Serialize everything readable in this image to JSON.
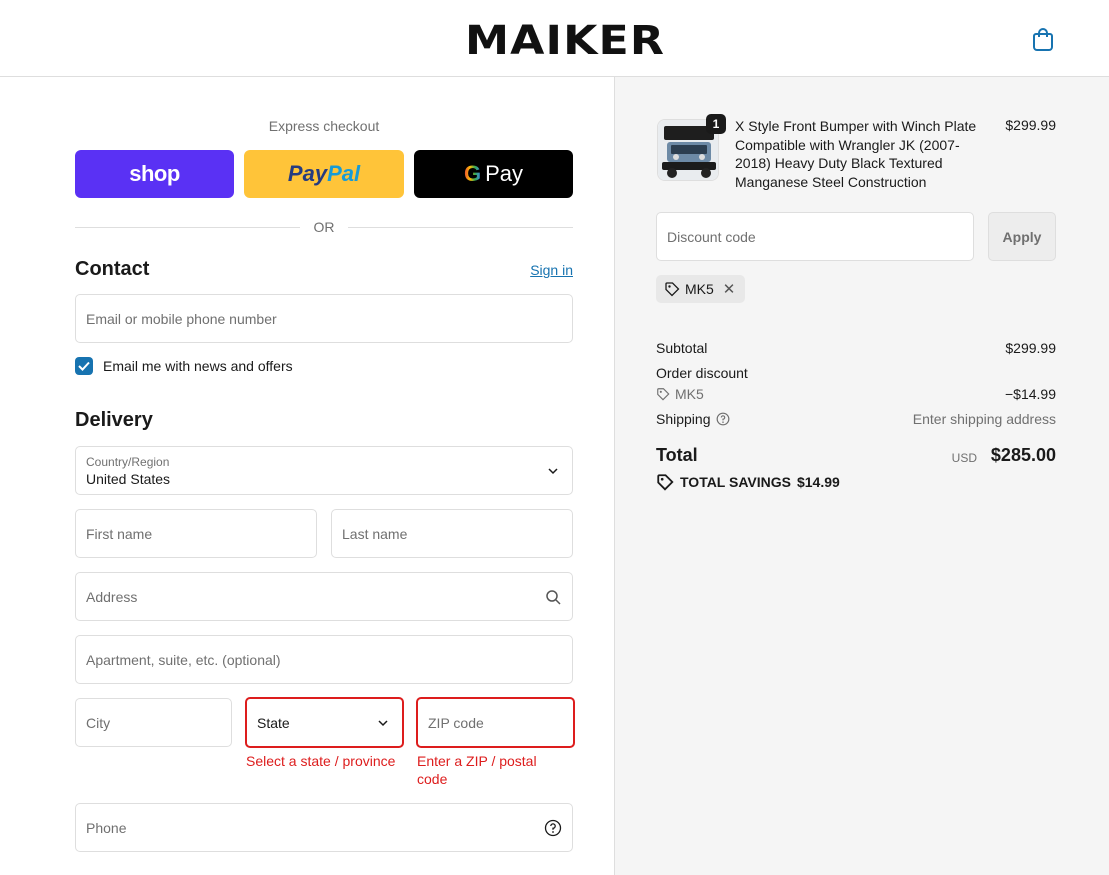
{
  "brand": {
    "logo_text": "MAIKER"
  },
  "express": {
    "title": "Express checkout",
    "shop_label": "shop",
    "paypal_label_1": "Pay",
    "paypal_label_2": "Pal",
    "gpay_g": "G",
    "gpay_label": "Pay",
    "or_text": "OR"
  },
  "contact": {
    "title": "Contact",
    "signin_label": "Sign in",
    "email_placeholder": "Email or mobile phone number",
    "newsletter_label": "Email me with news and offers",
    "newsletter_checked": true
  },
  "delivery": {
    "title": "Delivery",
    "country_label": "Country/Region",
    "country_value": "United States",
    "first_name_placeholder": "First name",
    "last_name_placeholder": "Last name",
    "address_placeholder": "Address",
    "apartment_placeholder": "Apartment, suite, etc. (optional)",
    "city_placeholder": "City",
    "state_placeholder": "State",
    "state_error": "Select a state / province",
    "zip_placeholder": "ZIP code",
    "zip_error": "Enter a ZIP / postal code",
    "phone_placeholder": "Phone"
  },
  "order": {
    "item": {
      "quantity": "1",
      "name": "X Style Front Bumper with Winch Plate Compatible with Wrangler JK (2007-2018) Heavy Duty Black Textured Manganese Steel Construction",
      "price": "$299.99"
    },
    "discount_placeholder": "Discount code",
    "apply_label": "Apply",
    "applied_code": "MK5",
    "subtotal_label": "Subtotal",
    "subtotal_value": "$299.99",
    "order_discount_label": "Order discount",
    "discount_code": "MK5",
    "discount_value": "−$14.99",
    "shipping_label": "Shipping",
    "shipping_value": "Enter shipping address",
    "total_label": "Total",
    "currency": "USD",
    "total_value": "$285.00",
    "savings_label": "TOTAL SAVINGS",
    "savings_value": "$14.99"
  },
  "colors": {
    "accent": "#1773b0",
    "shop_pay": "#5a31f4",
    "paypal": "#ffc439",
    "error": "#dd1d1d"
  }
}
